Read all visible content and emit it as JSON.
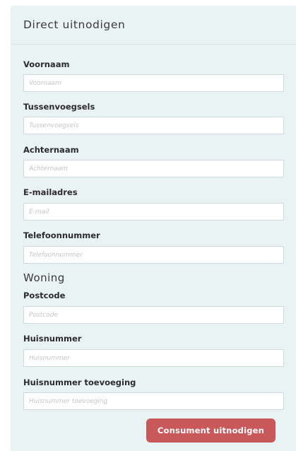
{
  "panel": {
    "title": "Direct uitnodigen"
  },
  "fields": {
    "voornaam": {
      "label": "Voornaam",
      "placeholder": "Voornaam",
      "value": ""
    },
    "tussenvoegsels": {
      "label": "Tussenvoegsels",
      "placeholder": "Tussenvoegsels",
      "value": ""
    },
    "achternaam": {
      "label": "Achternaam",
      "placeholder": "Achternaam",
      "value": ""
    },
    "email": {
      "label": "E-mailadres",
      "placeholder": "E-mail",
      "value": ""
    },
    "telefoon": {
      "label": "Telefoonnummer",
      "placeholder": "Telefoonnummer",
      "value": ""
    },
    "postcode": {
      "label": "Postcode",
      "placeholder": "Postcode",
      "value": ""
    },
    "huisnummer": {
      "label": "Huisnummer",
      "placeholder": "Huisnummer",
      "value": ""
    },
    "toevoeging": {
      "label": "Huisnummer toevoeging",
      "placeholder": "Huisnummer toevoeging",
      "value": ""
    }
  },
  "sections": {
    "woning": "Woning"
  },
  "actions": {
    "submit_label": "Consument uitnodigen"
  },
  "colors": {
    "panel_background": "#eaf3f4",
    "submit_button": "#c9585a"
  }
}
